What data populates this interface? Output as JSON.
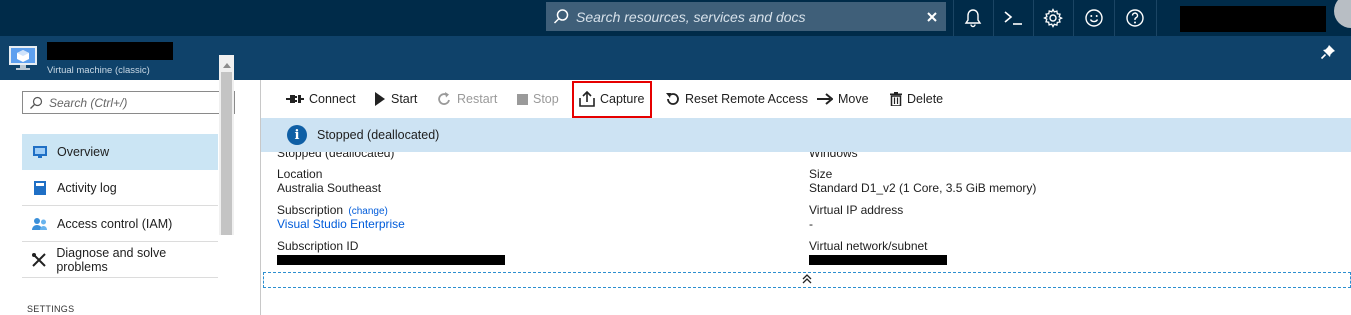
{
  "topbar": {
    "search_placeholder": "Search resources, services and docs",
    "icons": [
      "search-icon",
      "close-icon",
      "bell-icon",
      "cloud-shell-icon",
      "gear-icon",
      "smiley-icon",
      "help-icon"
    ]
  },
  "blade": {
    "subtitle": "Virtual machine (classic)"
  },
  "nav": {
    "search_placeholder": "Search (Ctrl+/)",
    "items": [
      {
        "label": "Overview",
        "icon": "monitor-icon",
        "active": true
      },
      {
        "label": "Activity log",
        "icon": "book-icon",
        "active": false
      },
      {
        "label": "Access control (IAM)",
        "icon": "people-icon",
        "active": false
      },
      {
        "label": "Diagnose and solve problems",
        "icon": "wrench-icon",
        "active": false
      }
    ],
    "section_heading": "SETTINGS"
  },
  "toolbar": {
    "buttons": [
      {
        "label": "Connect",
        "icon": "plug-icon",
        "enabled": true
      },
      {
        "label": "Start",
        "icon": "play-icon",
        "enabled": true
      },
      {
        "label": "Restart",
        "icon": "restart-icon",
        "enabled": false
      },
      {
        "label": "Stop",
        "icon": "stop-icon",
        "enabled": false
      },
      {
        "label": "Capture",
        "icon": "upload-icon",
        "enabled": true,
        "highlighted": true
      },
      {
        "label": "Reset Remote Access",
        "icon": "reset-icon",
        "enabled": true
      },
      {
        "label": "Move",
        "icon": "arrow-right-icon",
        "enabled": true
      },
      {
        "label": "Delete",
        "icon": "trash-icon",
        "enabled": true
      }
    ]
  },
  "banner": {
    "text": "Stopped (deallocated)"
  },
  "essentials": {
    "left": {
      "clipped_top": "Stopped (deallocated)",
      "location_label": "Location",
      "location_value": "Australia Southeast",
      "subscription_label": "Subscription",
      "subscription_change": "(change)",
      "subscription_value": "Visual Studio Enterprise",
      "subscription_id_label": "Subscription ID"
    },
    "right": {
      "clipped_top": "Windows",
      "size_label": "Size",
      "size_value": "Standard D1_v2 (1 Core, 3.5 GiB memory)",
      "vip_label": "Virtual IP address",
      "vip_value": "-",
      "vnet_label": "Virtual network/subnet"
    }
  },
  "colors": {
    "topbar": "#002b49",
    "blade_header": "#0f426a",
    "banner": "#cde3f3",
    "nav_active": "#cbe5f4",
    "link": "#015cda",
    "highlight": "#e60000"
  }
}
